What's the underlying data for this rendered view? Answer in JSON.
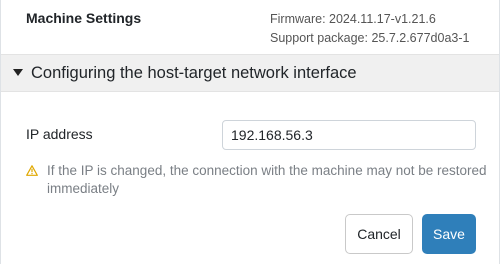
{
  "header": {
    "title": "Machine Settings",
    "firmware": "Firmware: 2024.11.17-v1.21.6",
    "support_package": "Support package: 25.7.2.677d0a3-1"
  },
  "section": {
    "title": "Configuring the host-target network interface",
    "expanded": true
  },
  "form": {
    "ip_label": "IP address",
    "ip_value": "192.168.56.3"
  },
  "warning": {
    "icon": "warning-triangle",
    "color": "#e0a800",
    "text": "If the IP is changed, the connection with the machine may not be restored immediately"
  },
  "buttons": {
    "cancel": "Cancel",
    "save": "Save",
    "save_color": "#2f7fba"
  }
}
